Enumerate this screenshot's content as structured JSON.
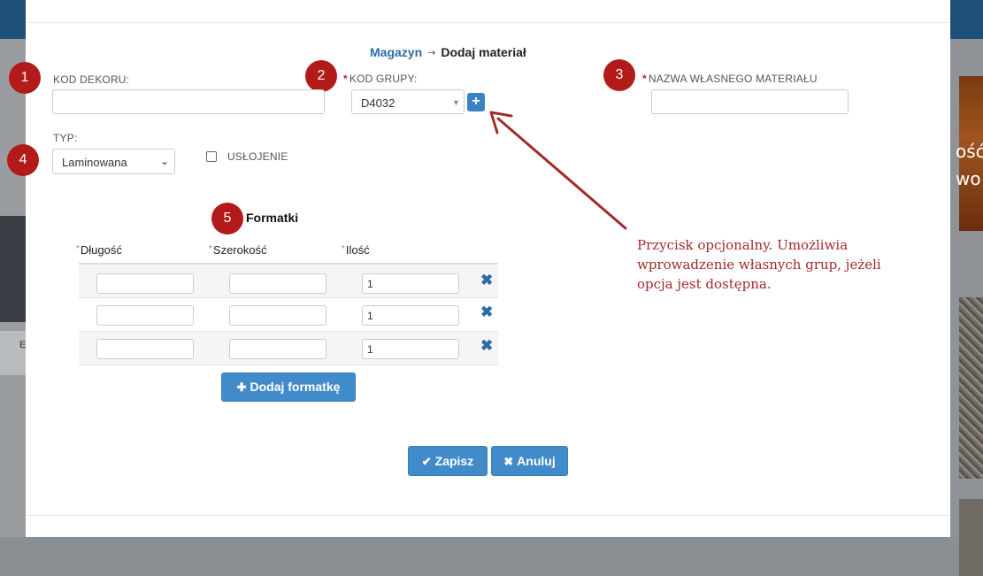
{
  "breadcrumb": {
    "parent": "Magazyn",
    "separator": "➝",
    "current": "Dodaj materiał"
  },
  "markers": [
    "1",
    "2",
    "3",
    "4",
    "5"
  ],
  "fields": {
    "kod_dekoru": {
      "label": "KOD DEKORU:",
      "value": "",
      "required": false
    },
    "kod_grupy": {
      "label": "KOD GRUPY:",
      "value": "D4032",
      "required": true,
      "required_mark": "*"
    },
    "nazwa": {
      "label": "NAZWA WŁASNEGO MATERIAŁU",
      "value": "",
      "required": true,
      "required_mark": "*"
    },
    "typ": {
      "label": "TYP:",
      "value": "Laminowana"
    },
    "uslojenie": {
      "label": "USŁOJENIE",
      "checked": false
    }
  },
  "add_group_button": {
    "label": "+"
  },
  "formatki": {
    "title": "Formatki",
    "columns": [
      {
        "mark": "*",
        "label": "Długość"
      },
      {
        "mark": "*",
        "label": "Szerokość"
      },
      {
        "mark": "*",
        "label": "Ilość"
      }
    ],
    "rows": [
      {
        "dlugosc": "",
        "szerokosc": "",
        "ilosc": "1"
      },
      {
        "dlugosc": "",
        "szerokosc": "",
        "ilosc": "1"
      },
      {
        "dlugosc": "",
        "szerokosc": "",
        "ilosc": "1"
      }
    ],
    "delete_icon": "✖",
    "add_button": {
      "icon": "✚",
      "label": "Dodaj formatkę"
    }
  },
  "footer": {
    "save": {
      "icon": "✔",
      "label": "Zapisz"
    },
    "cancel": {
      "icon": "✖",
      "label": "Anuluj"
    }
  },
  "annotation": {
    "text": "Przycisk opcjonalny. Umożliwia wprowadzenie własnych grup, jeżeli opcja jest dostępna.",
    "color": "#a32a2a"
  },
  "background": {
    "right_text_1": "ość",
    "right_text_2": "wo",
    "left_char": "E"
  },
  "colors": {
    "marker": "#b31a1a",
    "accent": "#428bca",
    "link": "#2c6ca3",
    "required": "#c2185b"
  }
}
